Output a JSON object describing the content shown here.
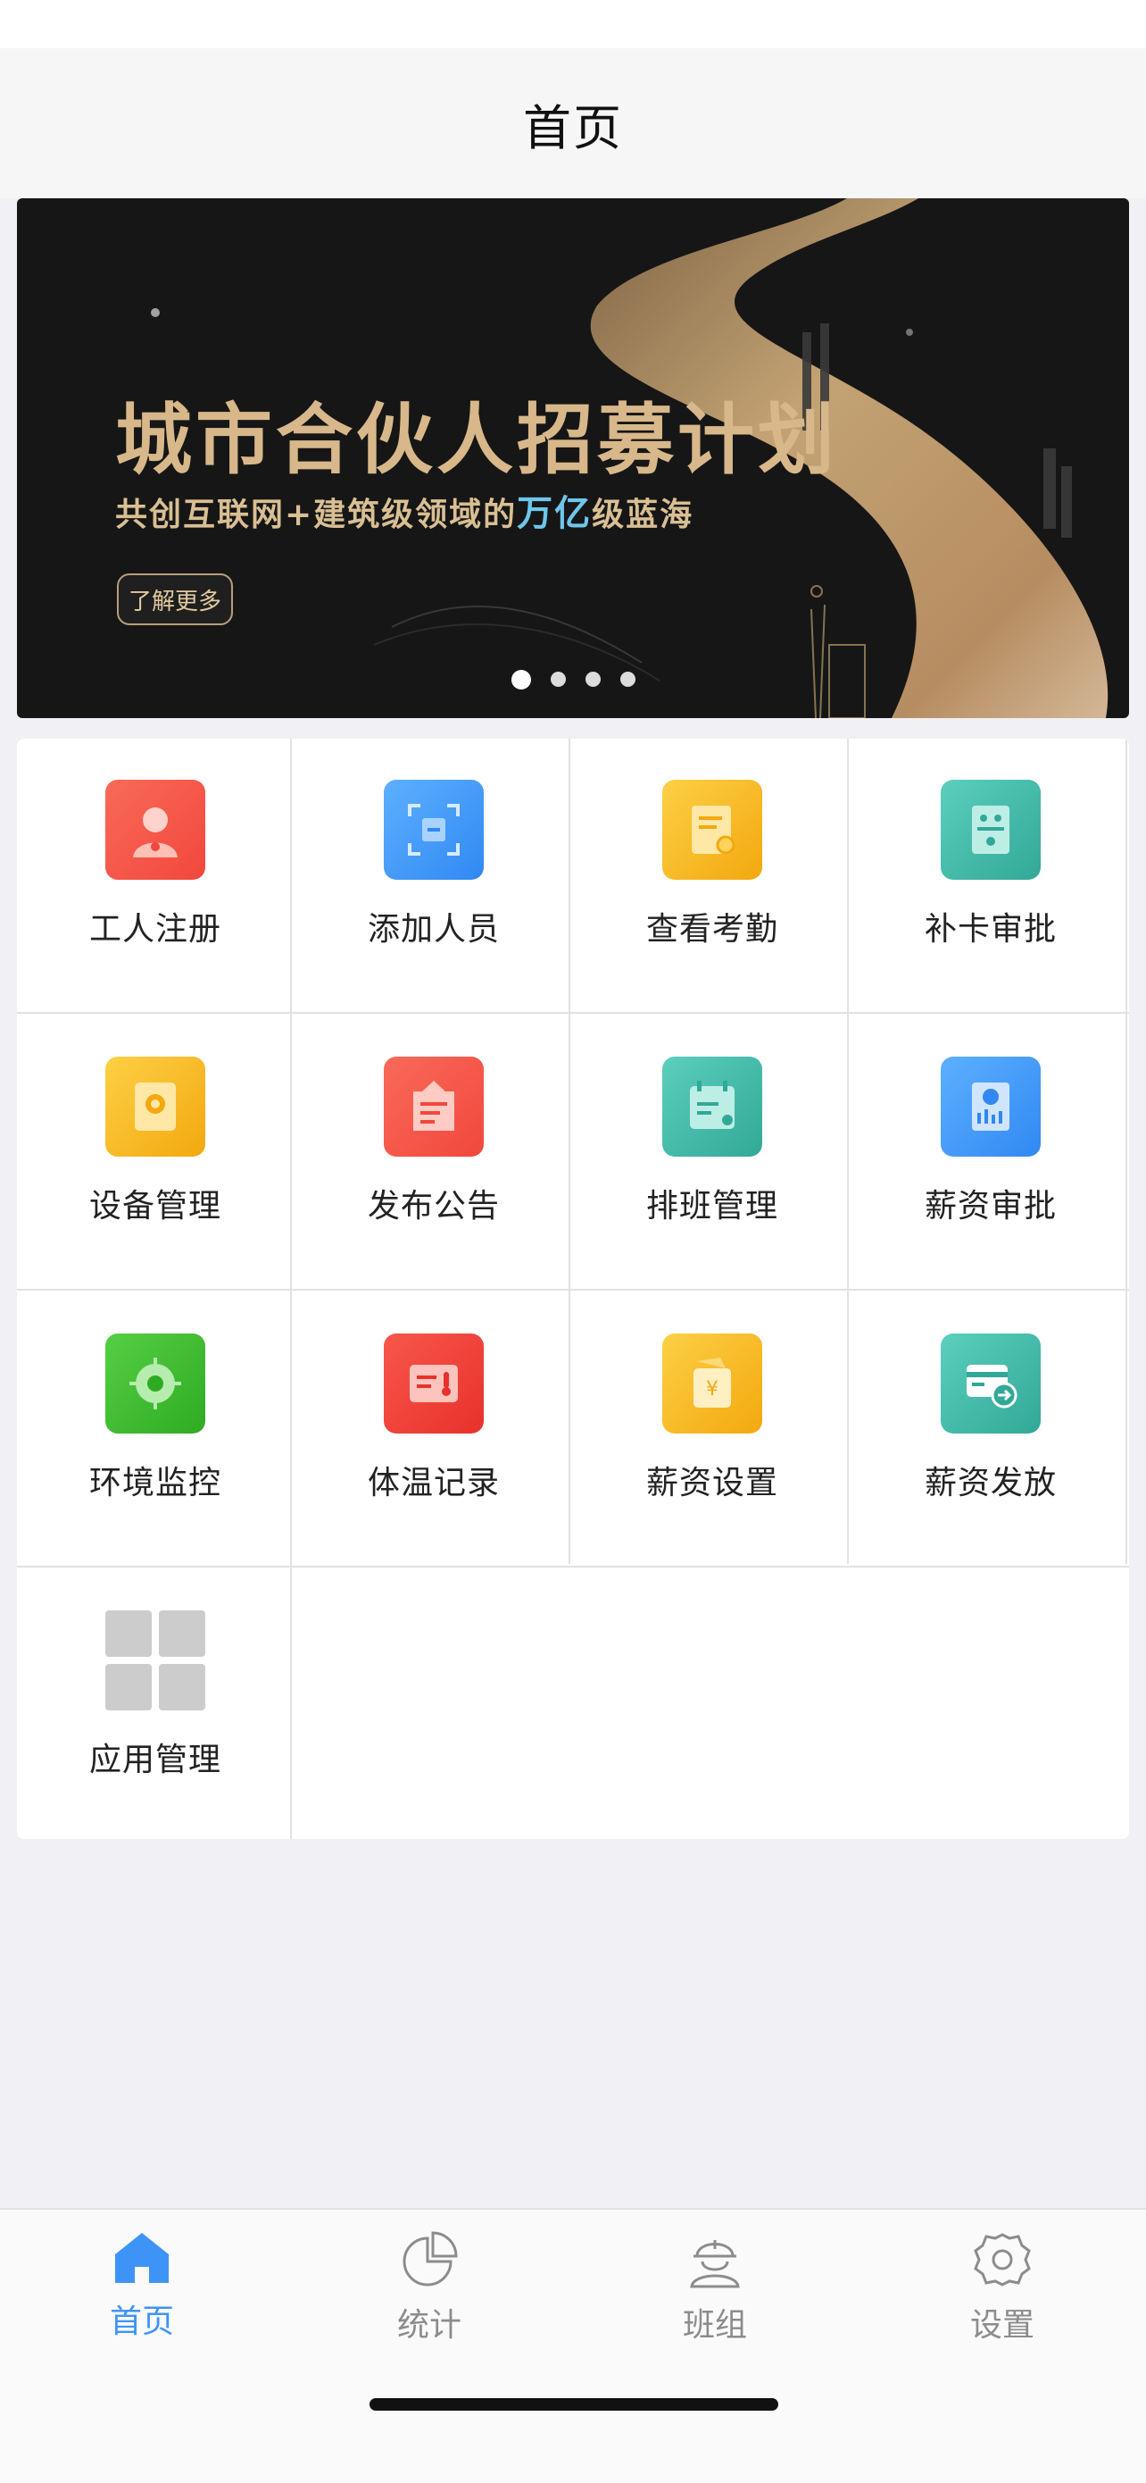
{
  "nav": {
    "title": "首页"
  },
  "banner": {
    "title": "城市合伙人招募计划",
    "subtitle_pre": "共创互联网+建筑级领域的",
    "subtitle_highlight": "万亿",
    "subtitle_post": "级蓝海",
    "button_label": "了解更多",
    "page_count": 4,
    "active_page": 1
  },
  "apps": [
    {
      "label": "工人注册",
      "icon": "worker-register-icon",
      "color": "#f4584a"
    },
    {
      "label": "添加人员",
      "icon": "add-person-icon",
      "color": "#3f95f6"
    },
    {
      "label": "查看考勤",
      "icon": "attendance-icon",
      "color": "#f6b824"
    },
    {
      "label": "补卡审批",
      "icon": "card-approval-icon",
      "color": "#3fb8a8"
    },
    {
      "label": "设备管理",
      "icon": "device-management-icon",
      "color": "#f6b824"
    },
    {
      "label": "发布公告",
      "icon": "announcement-icon",
      "color": "#f4584a"
    },
    {
      "label": "排班管理",
      "icon": "schedule-icon",
      "color": "#3fb8a8"
    },
    {
      "label": "薪资审批",
      "icon": "salary-approval-icon",
      "color": "#3f95f6"
    },
    {
      "label": "环境监控",
      "icon": "environment-monitor-icon",
      "color": "#3fc02e"
    },
    {
      "label": "体温记录",
      "icon": "temperature-icon",
      "color": "#f0403a"
    },
    {
      "label": "薪资设置",
      "icon": "salary-settings-icon",
      "color": "#f6b824"
    },
    {
      "label": "薪资发放",
      "icon": "salary-payout-icon",
      "color": "#3fb8a8"
    },
    {
      "label": "应用管理",
      "icon": "app-management-icon",
      "color": "#cccccc"
    }
  ],
  "tabs": [
    {
      "label": "首页",
      "icon": "home-icon",
      "active": true
    },
    {
      "label": "统计",
      "icon": "pie-chart-icon",
      "active": false
    },
    {
      "label": "班组",
      "icon": "worker-helmet-icon",
      "active": false
    },
    {
      "label": "设置",
      "icon": "gear-icon",
      "active": false
    }
  ],
  "colors": {
    "accent": "#3e94f6",
    "inactive": "#8c8c8c",
    "banner_gold": "#d8b88a"
  }
}
